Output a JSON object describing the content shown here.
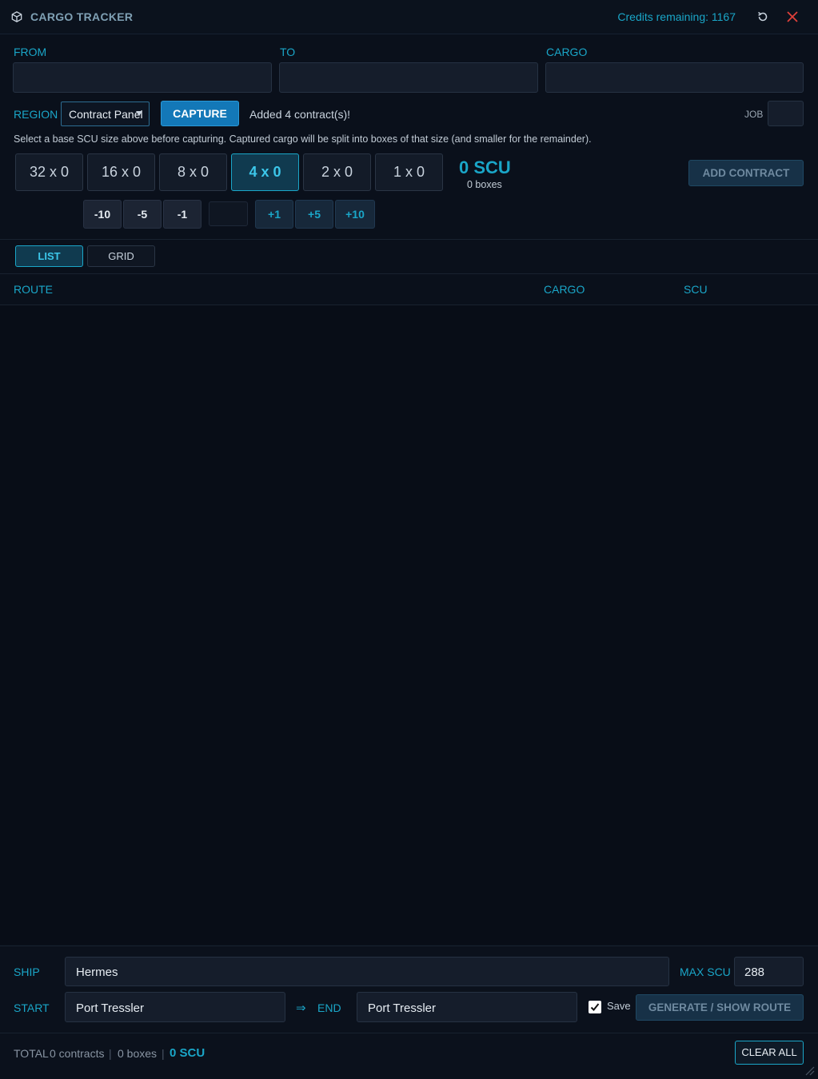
{
  "app": {
    "title": "CARGO TRACKER",
    "credits": "Credits remaining: 1167"
  },
  "fields": {
    "from_label": "FROM",
    "from_value": "",
    "to_label": "TO",
    "to_value": "",
    "cargo_label": "CARGO",
    "cargo_value": ""
  },
  "capture": {
    "region_label": "REGION",
    "region_value": "Contract Panel",
    "capture_label": "CAPTURE",
    "status": "Added 4 contract(s)!",
    "job_label": "JOB",
    "job_value": "",
    "hint": "Select a base SCU size above before capturing. Captured cargo will be split into boxes of that size (and smaller for the remainder)."
  },
  "sizes": [
    {
      "label": "32 x 0",
      "active": false
    },
    {
      "label": "16 x 0",
      "active": false
    },
    {
      "label": "8 x 0",
      "active": false
    },
    {
      "label": "4 x 0",
      "active": true
    },
    {
      "label": "2 x 0",
      "active": false
    },
    {
      "label": "1 x 0",
      "active": false
    }
  ],
  "summary": {
    "scu": "0 SCU",
    "boxes": "0 boxes"
  },
  "add_contract_label": "ADD CONTRACT",
  "adjust": {
    "minus10": "-10",
    "minus5": "-5",
    "minus1": "-1",
    "value": "",
    "plus1": "+1",
    "plus5": "+5",
    "plus10": "+10"
  },
  "tabs": {
    "list": "LIST",
    "grid": "GRID",
    "active": "list"
  },
  "columns": {
    "route": "ROUTE",
    "cargo": "CARGO",
    "scu": "SCU"
  },
  "ship": {
    "ship_label": "SHIP",
    "ship_value": "Hermes",
    "max_label": "MAX SCU",
    "max_value": "288"
  },
  "route": {
    "start_label": "START",
    "start_value": "Port Tressler",
    "arrow": "⇒",
    "end_label": "END",
    "end_value": "Port Tressler",
    "save_label": "Save",
    "save_checked": true,
    "generate_label": "GENERATE / SHOW ROUTE"
  },
  "totals": {
    "label": "TOTAL",
    "contracts": "0 contracts",
    "sep": "|",
    "boxes": "0 boxes",
    "scu": "0 SCU"
  },
  "clear_all_label": "CLEAR ALL",
  "colors": {
    "accent": "#1aa6c8",
    "primary": "#1378b8",
    "close": "#e0403a"
  }
}
